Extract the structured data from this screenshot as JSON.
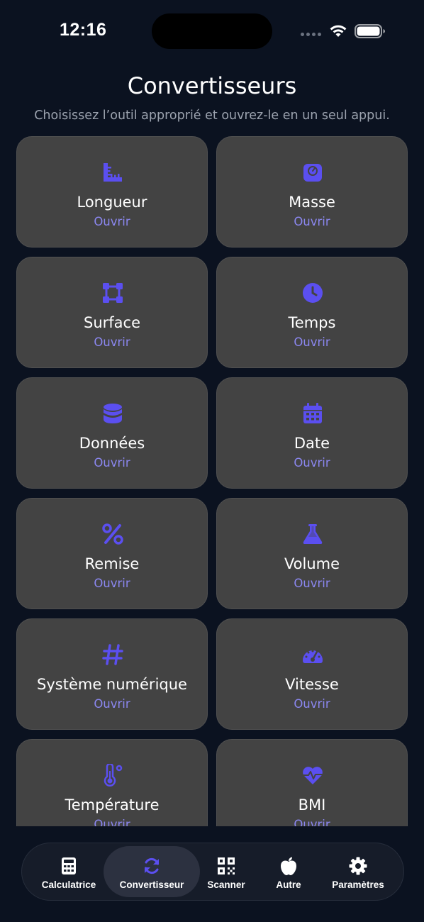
{
  "status_bar": {
    "time": "12:16"
  },
  "header": {
    "title": "Convertisseurs",
    "subtitle": "Choisissez l’outil approprié et ouvrez-le en un seul appui."
  },
  "colors": {
    "accent": "#5b4ff0",
    "action_text": "#8b87f0",
    "card_bg": "#434343",
    "page_bg": "#0b1220"
  },
  "converters": [
    {
      "title": "Longueur",
      "action": "Ouvrir",
      "icon": "ruler-icon"
    },
    {
      "title": "Masse",
      "action": "Ouvrir",
      "icon": "weight-scale-icon"
    },
    {
      "title": "Surface",
      "action": "Ouvrir",
      "icon": "vector-square-icon"
    },
    {
      "title": "Temps",
      "action": "Ouvrir",
      "icon": "clock-icon"
    },
    {
      "title": "Données",
      "action": "Ouvrir",
      "icon": "database-icon"
    },
    {
      "title": "Date",
      "action": "Ouvrir",
      "icon": "calendar-icon"
    },
    {
      "title": "Remise",
      "action": "Ouvrir",
      "icon": "percent-icon"
    },
    {
      "title": "Volume",
      "action": "Ouvrir",
      "icon": "flask-icon"
    },
    {
      "title": "Système numérique",
      "action": "Ouvrir",
      "icon": "hashtag-icon"
    },
    {
      "title": "Vitesse",
      "action": "Ouvrir",
      "icon": "speedometer-icon"
    },
    {
      "title": "Température",
      "action": "Ouvrir",
      "icon": "thermometer-icon"
    },
    {
      "title": "BMI",
      "action": "Ouvrir",
      "icon": "heart-pulse-icon"
    }
  ],
  "tab_bar": {
    "active": "Convertisseur",
    "tabs": [
      {
        "label": "Calculatrice",
        "icon": "calculator-icon"
      },
      {
        "label": "Convertisseur",
        "icon": "sync-icon"
      },
      {
        "label": "Scanner",
        "icon": "qrcode-icon"
      },
      {
        "label": "Autre",
        "icon": "apple-icon"
      },
      {
        "label": "Paramètres",
        "icon": "gear-icon"
      }
    ]
  }
}
